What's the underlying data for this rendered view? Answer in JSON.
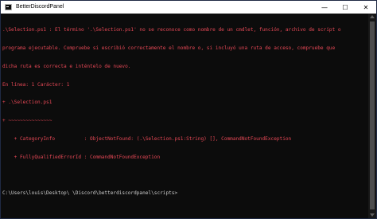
{
  "window": {
    "title": "BetterDiscordPanel",
    "icon": "console-icon"
  },
  "controls": {
    "minimize": "—",
    "maximize": "☐",
    "close": "✕"
  },
  "colors": {
    "error": "#e74856",
    "output": "#cccccc",
    "background": "#0c0c0c"
  },
  "console": {
    "error_lines": [
      ".\\Selection.ps1 : El término '.\\Selection.ps1' no se reconoce como nombre de un cmdlet, función, archivo de script o",
      "programa ejecutable. Compruebe si escribió correctamente el nombre o, si incluyó una ruta de acceso, compruebe que",
      "dicha ruta es correcta e inténtelo de nuevo.",
      "En línea: 1 Carácter: 1",
      "+ .\\Selection.ps1",
      "+ ~~~~~~~~~~~~~~~",
      "    + CategoryInfo          : ObjectNotFound: (.\\Selection.ps1:String) [], CommandNotFoundException",
      "    + FullyQualifiedErrorId : CommandNotFoundException"
    ],
    "prompt": "C:\\Users\\louis\\Desktop\\ \\Discord\\betterdiscordpanel\\scripts>"
  }
}
